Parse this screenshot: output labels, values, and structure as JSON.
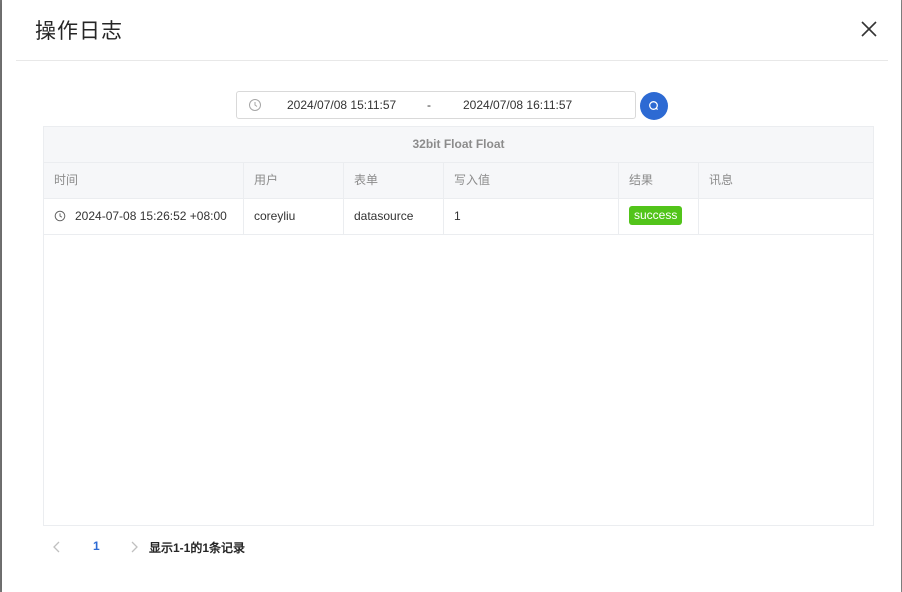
{
  "dialog": {
    "title": "操作日志"
  },
  "date_range": {
    "start": "2024/07/08 15:11:57",
    "separator": "-",
    "end": "2024/07/08 16:11:57"
  },
  "table": {
    "caption": "32bit Float Float",
    "columns": [
      "时间",
      "用户",
      "表单",
      "写入值",
      "结果",
      "讯息"
    ],
    "rows": [
      {
        "time": "2024-07-08 15:26:52 +08:00",
        "user": "coreyliu",
        "form": "datasource",
        "value": "1",
        "result": "success",
        "message": ""
      }
    ]
  },
  "pagination": {
    "current_page": "1",
    "summary": "显示1-1的1条记录"
  },
  "colors": {
    "accent": "#2d6ad3",
    "success": "#52c41a",
    "header_bg": "#f6f7f9"
  },
  "icons": {
    "close": "close-icon",
    "clock": "clock-icon",
    "search": "search-icon",
    "prev": "chevron-left-icon",
    "next": "chevron-right-icon"
  }
}
